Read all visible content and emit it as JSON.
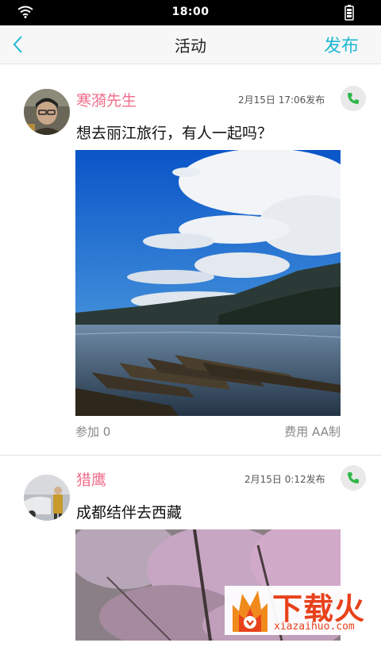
{
  "status_bar": {
    "time": "18:00"
  },
  "header": {
    "title": "活动",
    "publish_label": "发布"
  },
  "posts": [
    {
      "username": "寒漪先生",
      "time": "2月15日 17:06发布",
      "content": "想去丽江旅行，有人一起吗？",
      "participants": "参加 0",
      "cost": "费用 AA制"
    },
    {
      "username": "猎鹰",
      "time": "2月15日 0:12发布",
      "content": "成都结伴去西藏"
    }
  ],
  "watermark": {
    "brand": "下载火",
    "url": "xiazaihuo.com"
  },
  "colors": {
    "accent": "#1eb8d4",
    "username": "#ef6e8a",
    "call": "#2fb84a"
  }
}
